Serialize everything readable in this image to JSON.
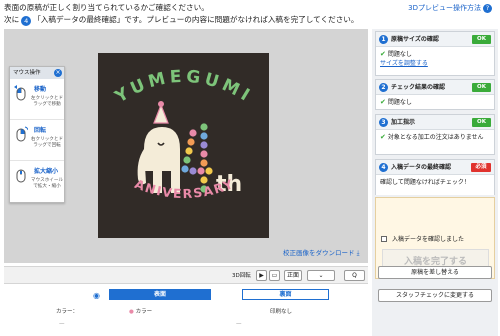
{
  "header": {
    "line1": "表面の原稿が正しく割り当てられているかご確認ください。",
    "line2_pre": "次に",
    "step_num": "4",
    "line2_post": "「入稿データの最終確認」です。プレビューの内容に問題がなければ入稿を完了してください。",
    "help_link": "3Dプレビュー操作方法",
    "help_icon": "?"
  },
  "mouse_panel": {
    "title": "マウス操作",
    "close": "×",
    "items": [
      {
        "label": "移動",
        "desc": "左クリックとドラッグで移動"
      },
      {
        "label": "回転",
        "desc": "右クリックとドラッグで回転"
      },
      {
        "label": "拡大縮小",
        "desc": "マウスホイールで拡大・縮小"
      }
    ]
  },
  "artwork": {
    "line1": "YUMEGUMI",
    "anniv_suffix": "th",
    "line2": "ANIVERSARY",
    "colors": {
      "bg": "#312b27",
      "cream": "#f4ecd8",
      "yellow": "#f2c94c",
      "green": "#7dc47a",
      "blue": "#6fa9dc",
      "pink": "#e98aa8",
      "orange": "#f29b55",
      "purple": "#9a8bd4"
    }
  },
  "download_link": "校正画像をダウンロード",
  "toolbar": {
    "label_3d": "3D回転",
    "play": "▶",
    "front": "正面",
    "zoom": "Q"
  },
  "faces": {
    "front": "表面",
    "back": "裏面"
  },
  "attrs": {
    "color_label": "カラー：",
    "color_value": "カラー",
    "print_value": "印刷なし",
    "row2_left": "—",
    "row2_right": "—"
  },
  "sidebar": {
    "cards": [
      {
        "num": "1",
        "title": "原稿サイズの確認",
        "status": "OK",
        "body": "問題なし",
        "link": "サイズを調整する"
      },
      {
        "num": "2",
        "title": "チェック結果の確認",
        "status": "OK",
        "body": "問題なし"
      },
      {
        "num": "3",
        "title": "加工指示",
        "status": "OK",
        "body": "対象となる加工の注文はありません"
      }
    ],
    "final": {
      "num": "4",
      "title": "入稿データの最終確認",
      "status": "必須",
      "msg": "確認して問題なければチェック！",
      "checkbox": "入稿データを確認しました",
      "button": "入稿を完了する"
    },
    "replace_button": "原稿を差し替える",
    "staff_button": "スタッフチェックに変更する"
  },
  "accent": "#1f6fd1"
}
